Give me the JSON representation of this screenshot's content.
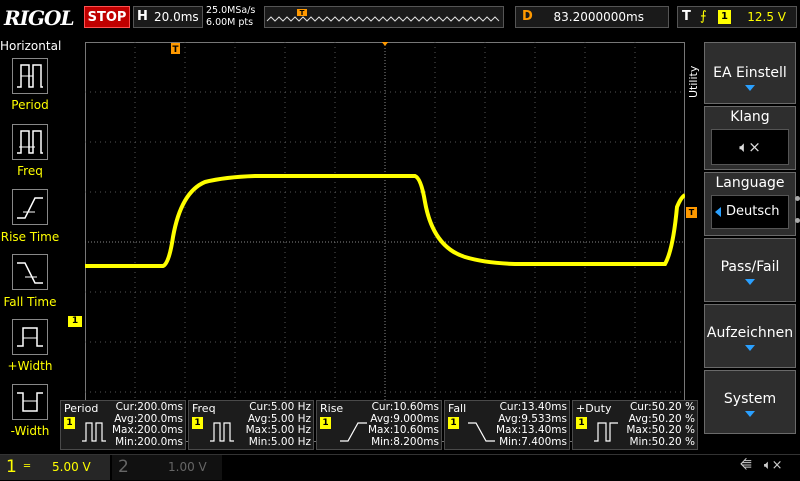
{
  "header": {
    "logo": "RIGOL",
    "run_state": "STOP",
    "horizontal_label": "H",
    "timebase": "20.0ms",
    "sample_rate": "25.0MSa/s",
    "memory_depth": "6.00M pts",
    "delay_label": "D",
    "delay_value": "83.2000000ms",
    "trigger_label": "T",
    "trigger_source": "1",
    "trigger_level": "12.5 V"
  },
  "left_panel": {
    "title": "Horizontal",
    "buttons": [
      {
        "label": "Period"
      },
      {
        "label": "Freq"
      },
      {
        "label": "Rise Time"
      },
      {
        "label": "Fall Time"
      },
      {
        "label": "+Width"
      },
      {
        "label": "-Width"
      }
    ]
  },
  "screen": {
    "trigger_marker": "T",
    "ch1_marker": "1",
    "utility_tab": "Utility"
  },
  "right_menu": {
    "ea_einstell": "EA Einstell",
    "klang_title": "Klang",
    "language_title": "Language",
    "language_value": "Deutsch",
    "pass_fail": "Pass/Fail",
    "aufzeichnen": "Aufzeichnen",
    "system": "System"
  },
  "measurements": [
    {
      "name": "Period",
      "ch": "1",
      "cur": "Cur:200.0ms",
      "avg": "Avg:200.0ms",
      "max": "Max:200.0ms",
      "min": "Min:200.0ms"
    },
    {
      "name": "Freq",
      "ch": "1",
      "cur": "Cur:5.00 Hz",
      "avg": "Avg:5.00 Hz",
      "max": "Max:5.00 Hz",
      "min": "Min:5.00 Hz"
    },
    {
      "name": "Rise",
      "ch": "1",
      "cur": "Cur:10.60ms",
      "avg": "Avg:9.000ms",
      "max": "Max:10.60ms",
      "min": "Min:8.200ms"
    },
    {
      "name": "Fall",
      "ch": "1",
      "cur": "Cur:13.40ms",
      "avg": "Avg:9.533ms",
      "max": "Max:13.40ms",
      "min": "Min:7.400ms"
    },
    {
      "name": "+Duty",
      "ch": "1",
      "cur": "Cur:50.20 %",
      "avg": "Avg:50.20 %",
      "max": "Max:50.20 %",
      "min": "Min:50.20 %"
    }
  ],
  "channels": [
    {
      "num": "1",
      "scale": "5.00 V"
    },
    {
      "num": "2",
      "scale": "1.00 V"
    }
  ],
  "colors": {
    "ch1": "#ffff00",
    "accent": "#2aa0ff",
    "stop": "#c00000",
    "trigger": "#ff9900"
  }
}
